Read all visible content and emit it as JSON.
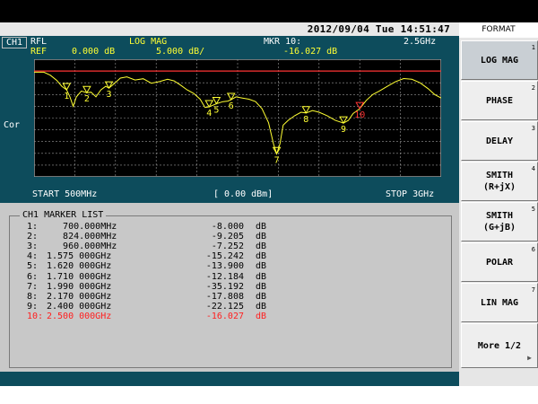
{
  "header": {
    "datetime": "2012/09/04 Tue 14:51:47",
    "format_title": "FORMAT"
  },
  "info": {
    "channel": "CH1",
    "param": "RFL",
    "format": "LOG MAG",
    "marker_label": "MKR 10:",
    "marker_freq": "2.5GHz",
    "ref_label": "REF",
    "ref_value": "0.000 dB",
    "scale": "5.000 dB/",
    "marker_value": "-16.027 dB"
  },
  "side_label": "Cor",
  "footer": {
    "start": "START 500MHz",
    "power": "[ 0.00 dBm]",
    "stop": "STOP 3GHz"
  },
  "marker_list": {
    "title": "CH1 MARKER LIST",
    "rows": [
      {
        "idx": "1:",
        "freq": "   700.000MHz",
        "value": "-8.000",
        "unit": "dB"
      },
      {
        "idx": "2:",
        "freq": "   824.000MHz",
        "value": "-9.205",
        "unit": "dB"
      },
      {
        "idx": "3:",
        "freq": "   960.000MHz",
        "value": "-7.252",
        "unit": "dB"
      },
      {
        "idx": "4:",
        "freq": "1.575 000GHz",
        "value": "-15.242",
        "unit": "dB"
      },
      {
        "idx": "5:",
        "freq": "1.620 000GHz",
        "value": "-13.900",
        "unit": "dB"
      },
      {
        "idx": "6:",
        "freq": "1.710 000GHz",
        "value": "-12.184",
        "unit": "dB"
      },
      {
        "idx": "7:",
        "freq": "1.990 000GHz",
        "value": "-35.192",
        "unit": "dB"
      },
      {
        "idx": "8:",
        "freq": "2.170 000GHz",
        "value": "-17.808",
        "unit": "dB"
      },
      {
        "idx": "9:",
        "freq": "2.400 000GHz",
        "value": "-22.125",
        "unit": "dB"
      },
      {
        "idx": "10:",
        "freq": "2.500 000GHz",
        "value": "-16.027",
        "unit": "dB"
      }
    ]
  },
  "softkeys": [
    {
      "label": "LOG MAG",
      "num": "1"
    },
    {
      "label": "PHASE",
      "num": "2"
    },
    {
      "label": "DELAY",
      "num": "3"
    },
    {
      "label": "SMITH\n(R+jX)",
      "num": "4"
    },
    {
      "label": "SMITH\n(G+jB)",
      "num": "5"
    },
    {
      "label": "POLAR",
      "num": "6"
    },
    {
      "label": "LIN MAG",
      "num": "7"
    },
    {
      "label": "More 1/2",
      "num": "",
      "arrow": "▶"
    }
  ],
  "chart_data": {
    "type": "line",
    "x_start_mhz": 500,
    "x_stop_mhz": 3000,
    "ref_db": 0,
    "scale_db_per_div": 5,
    "divisions": 10,
    "ylim": [
      -45,
      5
    ],
    "grid": true,
    "colors": {
      "trace": "#ffff33",
      "ref_line": "#ff3333",
      "active_marker": "#ff3333",
      "marker": "#ffff33",
      "grid": "#9a9a9a"
    },
    "markers": [
      {
        "id": "1",
        "x": 700,
        "y": -8.0
      },
      {
        "id": "2",
        "x": 824,
        "y": -9.205
      },
      {
        "id": "3",
        "x": 960,
        "y": -7.252
      },
      {
        "id": "4",
        "x": 1575,
        "y": -15.242
      },
      {
        "id": "5",
        "x": 1620,
        "y": -13.9
      },
      {
        "id": "6",
        "x": 1710,
        "y": -12.184
      },
      {
        "id": "7",
        "x": 1990,
        "y": -35.192
      },
      {
        "id": "8",
        "x": 2170,
        "y": -17.808
      },
      {
        "id": "9",
        "x": 2400,
        "y": -22.125
      },
      {
        "id": "10",
        "x": 2500,
        "y": -16.027
      }
    ],
    "trace": [
      [
        500,
        -0.5
      ],
      [
        560,
        -0.5
      ],
      [
        600,
        -1.8
      ],
      [
        640,
        -4
      ],
      [
        670,
        -6.5
      ],
      [
        700,
        -8.0
      ],
      [
        720,
        -11
      ],
      [
        740,
        -15
      ],
      [
        760,
        -11
      ],
      [
        790,
        -8.5
      ],
      [
        824,
        -9.205
      ],
      [
        850,
        -9
      ],
      [
        880,
        -11
      ],
      [
        910,
        -8
      ],
      [
        940,
        -6.5
      ],
      [
        960,
        -7.252
      ],
      [
        990,
        -5.5
      ],
      [
        1030,
        -3
      ],
      [
        1070,
        -2.5
      ],
      [
        1120,
        -3.8
      ],
      [
        1170,
        -3.3
      ],
      [
        1220,
        -5.2
      ],
      [
        1270,
        -4.5
      ],
      [
        1320,
        -3.5
      ],
      [
        1360,
        -4.2
      ],
      [
        1400,
        -6
      ],
      [
        1440,
        -8
      ],
      [
        1480,
        -9.5
      ],
      [
        1520,
        -12
      ],
      [
        1550,
        -15.5
      ],
      [
        1575,
        -15.242
      ],
      [
        1600,
        -14.5
      ],
      [
        1620,
        -13.9
      ],
      [
        1660,
        -13
      ],
      [
        1690,
        -12.8
      ],
      [
        1710,
        -12.184
      ],
      [
        1740,
        -11
      ],
      [
        1780,
        -11.5
      ],
      [
        1820,
        -12
      ],
      [
        1860,
        -13
      ],
      [
        1900,
        -16
      ],
      [
        1940,
        -22
      ],
      [
        1970,
        -31
      ],
      [
        1990,
        -35.192
      ],
      [
        2010,
        -31
      ],
      [
        2030,
        -23
      ],
      [
        2060,
        -21
      ],
      [
        2100,
        -19
      ],
      [
        2140,
        -17.5
      ],
      [
        2170,
        -17.808
      ],
      [
        2210,
        -16.8
      ],
      [
        2250,
        -17.5
      ],
      [
        2300,
        -19
      ],
      [
        2350,
        -21
      ],
      [
        2400,
        -22.125
      ],
      [
        2430,
        -21
      ],
      [
        2460,
        -18
      ],
      [
        2500,
        -16.027
      ],
      [
        2540,
        -12.5
      ],
      [
        2580,
        -10
      ],
      [
        2620,
        -8.5
      ],
      [
        2670,
        -6.5
      ],
      [
        2720,
        -4.5
      ],
      [
        2770,
        -3.2
      ],
      [
        2820,
        -3.5
      ],
      [
        2870,
        -5
      ],
      [
        2920,
        -7.5
      ],
      [
        2960,
        -10
      ],
      [
        3000,
        -11.5
      ]
    ]
  }
}
